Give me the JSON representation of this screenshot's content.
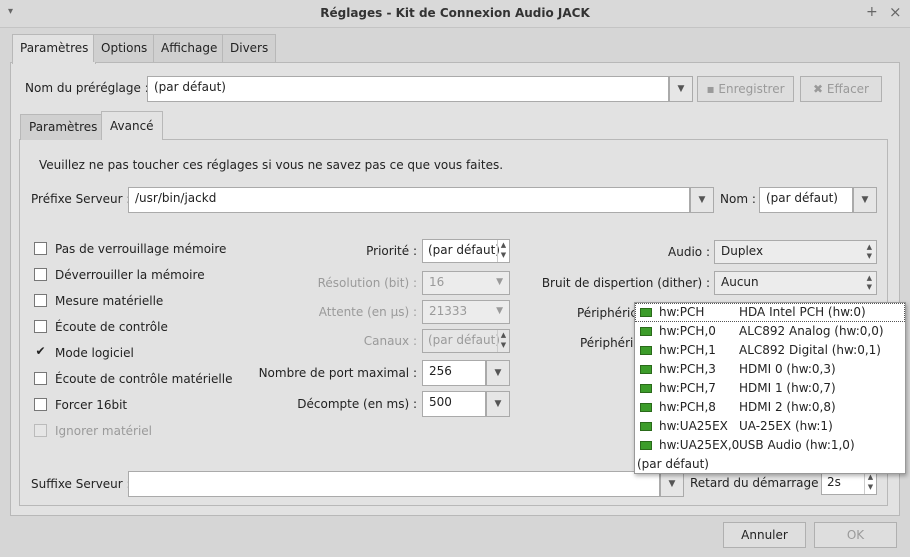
{
  "window": {
    "title": "Réglages - Kit de Connexion Audio JACK",
    "menu_icon": "▾",
    "pin_icon": "+",
    "close_icon": "×"
  },
  "tabs": [
    "Paramètres",
    "Options",
    "Affichage",
    "Divers"
  ],
  "preset": {
    "label": "Nom du préréglage :",
    "value": "(par défaut)",
    "save": "Enregistrer",
    "delete": "Effacer"
  },
  "subtabs": [
    "Paramètres",
    "Avancé"
  ],
  "warning": "Veuillez ne pas toucher ces réglages si vous ne savez pas ce que vous faites.",
  "server_prefix": {
    "label": "Préfixe Serveur :",
    "value": "/usr/bin/jackd"
  },
  "name": {
    "label": "Nom :",
    "value": "(par défaut)"
  },
  "checkboxes": [
    {
      "label": "Pas de verrouillage mémoire",
      "checked": false
    },
    {
      "label": "Déverrouiller la mémoire",
      "checked": false
    },
    {
      "label": "Mesure matérielle",
      "checked": false
    },
    {
      "label": "Écoute de contrôle",
      "checked": false
    },
    {
      "label": "Mode logiciel",
      "checked": true
    },
    {
      "label": "Écoute de contrôle matérielle",
      "checked": false
    },
    {
      "label": "Forcer 16bit",
      "checked": false
    },
    {
      "label": "Ignorer matériel",
      "checked": false,
      "disabled": true
    }
  ],
  "fields": {
    "priority": {
      "label": "Priorité :",
      "value": "(par défaut)"
    },
    "resolution": {
      "label": "Résolution (bit) :",
      "value": "16"
    },
    "wait": {
      "label": "Attente (en µs) :",
      "value": "21333"
    },
    "channels": {
      "label": "Canaux :",
      "value": "(par défaut)"
    },
    "max_ports": {
      "label": "Nombre de port maximal :",
      "value": "256"
    },
    "timeout": {
      "label": "Décompte (en ms) :",
      "value": "500"
    }
  },
  "audio": {
    "label": "Audio :",
    "value": "Duplex"
  },
  "dither": {
    "label": "Bruit de dispertion (dither) :",
    "value": "Aucun"
  },
  "device_in": {
    "label": "Périphéric"
  },
  "device_out": {
    "label": "Périphéric"
  },
  "device_list": [
    {
      "id": "hw:PCH",
      "name": "HDA Intel PCH (hw:0)"
    },
    {
      "id": "hw:PCH,0",
      "name": "ALC892 Analog (hw:0,0)"
    },
    {
      "id": "hw:PCH,1",
      "name": "ALC892 Digital (hw:0,1)"
    },
    {
      "id": "hw:PCH,3",
      "name": "HDMI 0 (hw:0,3)"
    },
    {
      "id": "hw:PCH,7",
      "name": "HDMI 1 (hw:0,7)"
    },
    {
      "id": "hw:PCH,8",
      "name": "HDMI 2 (hw:0,8)"
    },
    {
      "id": "hw:UA25EX",
      "name": "UA-25EX (hw:1)"
    },
    {
      "id": "hw:UA25EX,0",
      "name": "USB Audio (hw:1,0)"
    }
  ],
  "device_default": "(par défaut)",
  "server_suffix": {
    "label": "Suffixe Serveur :",
    "value": ""
  },
  "start_delay": {
    "label": "Retard du démarrage :",
    "value": "2s"
  },
  "buttons": {
    "cancel": "Annuler",
    "ok": "OK"
  }
}
